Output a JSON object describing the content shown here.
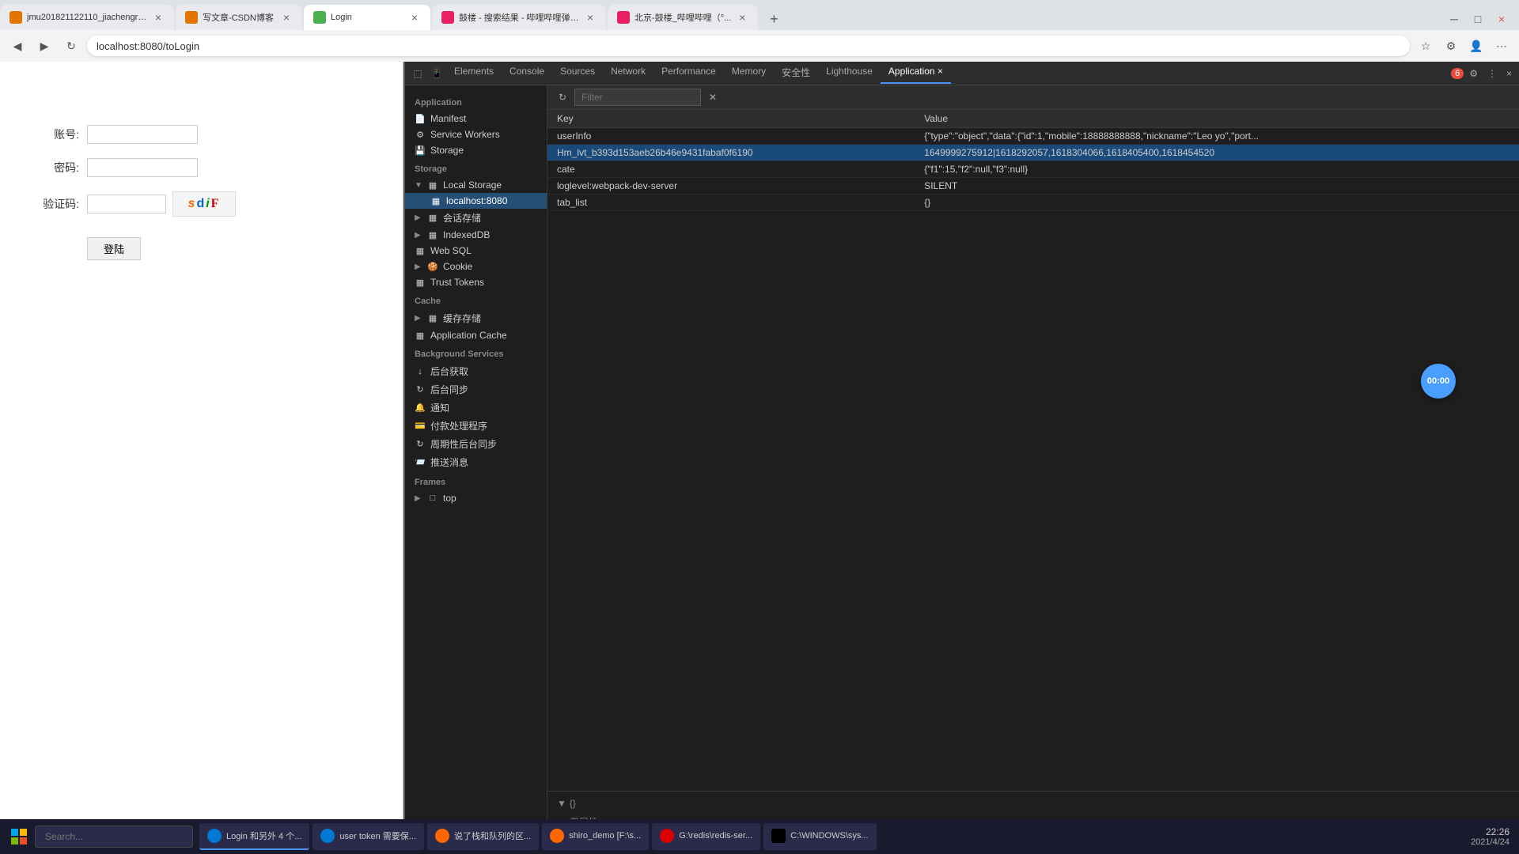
{
  "browser": {
    "tabs": [
      {
        "id": "tab1",
        "title": "jmu201821122110_jiachengren...",
        "url": "",
        "active": false,
        "color": "#e37400"
      },
      {
        "id": "tab2",
        "title": "写文章-CSDN博客",
        "url": "",
        "active": false,
        "color": "#e37400"
      },
      {
        "id": "tab3",
        "title": "Login",
        "url": "localhost:8080/toLogin",
        "active": true,
        "color": "#4caf50"
      },
      {
        "id": "tab4",
        "title": "鼓楼 - 搜索结果 - 哔哩哔哩弹幕...",
        "url": "",
        "active": false,
        "color": "#e91e63"
      },
      {
        "id": "tab5",
        "title": "北京-鼓楼_哔哩哔哩（°...",
        "url": "",
        "active": false,
        "color": "#e91e63"
      }
    ],
    "address": "localhost:8080/toLogin"
  },
  "login": {
    "username_label": "账号:",
    "password_label": "密码:",
    "captcha_label": "验证码:",
    "captcha_text": "s d i F",
    "login_btn": "登陆"
  },
  "devtools": {
    "tabs": [
      "Elements",
      "Console",
      "Sources",
      "Network",
      "Performance",
      "Memory",
      "安全性",
      "Lighthouse",
      "Application"
    ],
    "active_tab": "Application",
    "filter_placeholder": "Filter",
    "badge": "6",
    "sidebar": {
      "section_application": "Application",
      "manifest": "Manifest",
      "service_workers": "Service Workers",
      "storage_label": "Storage",
      "section_storage": "Storage",
      "local_storage": "Local Storage",
      "local_storage_host": "localhost:8080",
      "session_storage": "会话存储",
      "indexeddb": "IndexedDB",
      "web_sql": "Web SQL",
      "cookie": "Cookie",
      "trust_tokens": "Trust Tokens",
      "section_cache": "Cache",
      "cache_storage": "缓存存储",
      "application_cache": "Application Cache",
      "section_background": "Background Services",
      "bg_fetch": "后台获取",
      "bg_sync": "后台同步",
      "notifications": "通知",
      "payment": "付款处理程序",
      "periodic_sync": "周期性后台同步",
      "push_msg": "推送消息",
      "section_frames": "Frames",
      "top": "top"
    },
    "table": {
      "headers": [
        "Key",
        "Value"
      ],
      "rows": [
        {
          "key": "userInfo",
          "value": "{\"type\":\"object\",\"data\":{\"id\":1,\"mobile\":18888888888,\"nickname\":\"Leo yo\",\"port...",
          "selected": false
        },
        {
          "key": "Hm_lvt_b393d153aeb26b46e9431fabaf0f6190",
          "value": "1649999275912|1618292057,1618304066,1618405400,1618454520",
          "selected": true
        },
        {
          "key": "cate",
          "value": "{\"f1\":15,\"f2\":null,\"f3\":null}",
          "selected": false
        },
        {
          "key": "loglevel:webpack-dev-server",
          "value": "SILENT",
          "selected": false
        },
        {
          "key": "tab_list",
          "value": "{}",
          "selected": false
        }
      ]
    },
    "bottom": {
      "header": "{}",
      "property": "无属性"
    }
  },
  "taskbar": {
    "items": [
      {
        "label": "Login 和另外 4 个...",
        "active": true
      },
      {
        "label": "user token 需要保...",
        "active": false
      },
      {
        "label": "说了栈和队列的区...",
        "active": false
      },
      {
        "label": "shiro_demo [F:\\s...",
        "active": false
      },
      {
        "label": "G:\\redis\\redis-ser...",
        "active": false
      },
      {
        "label": "C:\\WINDOWS\\sys...",
        "active": false
      }
    ],
    "time": "22:26",
    "date": "2021/4/24"
  }
}
